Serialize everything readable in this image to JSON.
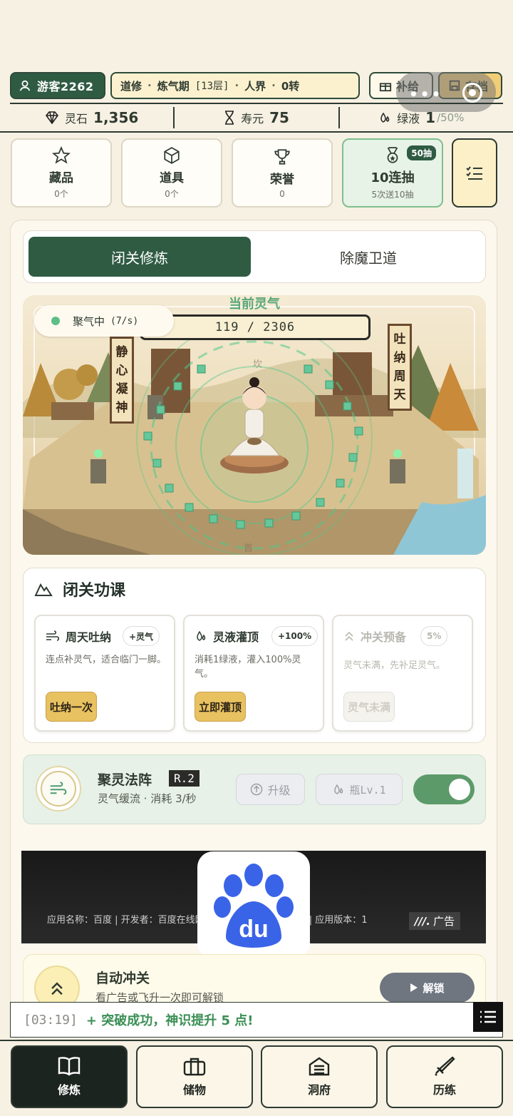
{
  "header": {
    "user_label": "游客2262",
    "realm": {
      "path": "道修",
      "stage": "炼气期",
      "layer": "[13层]",
      "world": "人界",
      "rebirth": "0转",
      "sep": "·"
    },
    "supply_label": "补给",
    "save_label": "存档"
  },
  "stats": {
    "spirit_stone": {
      "label": "灵石",
      "value": "1,356"
    },
    "lifespan": {
      "label": "寿元",
      "value": "75"
    },
    "green_liquid": {
      "label": "绿液",
      "value": "1",
      "max": "/50%"
    }
  },
  "categories": [
    {
      "name": "藏品",
      "count": "0个",
      "icon": "star-icon"
    },
    {
      "name": "道具",
      "count": "0个",
      "icon": "box-icon"
    },
    {
      "name": "荣誉",
      "count": "0",
      "icon": "trophy-icon"
    },
    {
      "name": "10连抽",
      "count": "5次送10抽",
      "badge": "50抽",
      "icon": "medal-icon"
    }
  ],
  "tabs": {
    "active": "闭关修炼",
    "other": "除魔卫道"
  },
  "scene": {
    "qi_title": "当前灵气",
    "qi_value": "119 / 2306",
    "qi_current": 119,
    "qi_max": 2306,
    "status": "聚气中",
    "rate": "(7/s)",
    "sign_left": "静心凝神",
    "sign_right": "吐纳周天",
    "trigram_top": "坎",
    "trigram_bottom": "首"
  },
  "lessons": {
    "title": "闭关功课",
    "cards": [
      {
        "name": "周天吐纳",
        "tag": "+灵气",
        "desc": "连点补灵气，适合临门一脚。",
        "button": "吐纳一次",
        "enabled": true
      },
      {
        "name": "灵液灌顶",
        "tag": "+100%",
        "desc": "消耗1绿液，灌入100%灵气。",
        "button": "立即灌顶",
        "enabled": true
      },
      {
        "name": "冲关预备",
        "tag": "5%",
        "desc": "灵气未满，先补足灵气。",
        "button": "灵气未满",
        "enabled": false
      }
    ]
  },
  "formation": {
    "name": "聚灵法阵",
    "rank": "R.2",
    "sub": "灵气缓流 · 消耗 3/秒",
    "upgrade_label": "升级",
    "bottle_label": "瓶Lv.1",
    "enabled": true
  },
  "ad": {
    "info": "应用名称：百度 | 开发者：百度在线网络技术（北京）有限公司 | 应用版本：1",
    "label": "广告",
    "logo_text": "du"
  },
  "auto": {
    "title": "自动冲关",
    "sub": "看广告或飞升一次即可解锁",
    "button": "解锁"
  },
  "log": {
    "time": "[03:19]",
    "message": "+ 突破成功，神识提升 5 点!"
  },
  "nav": [
    {
      "label": "修炼",
      "icon": "book-icon",
      "active": true
    },
    {
      "label": "储物",
      "icon": "bag-icon",
      "active": false
    },
    {
      "label": "洞府",
      "icon": "cave-icon",
      "active": false
    },
    {
      "label": "历练",
      "icon": "sword-icon",
      "active": false
    }
  ],
  "colors": {
    "primary": "#2f5b43",
    "accent": "#e8c161",
    "bg": "#f7f1e3",
    "success": "#3b8f55"
  }
}
